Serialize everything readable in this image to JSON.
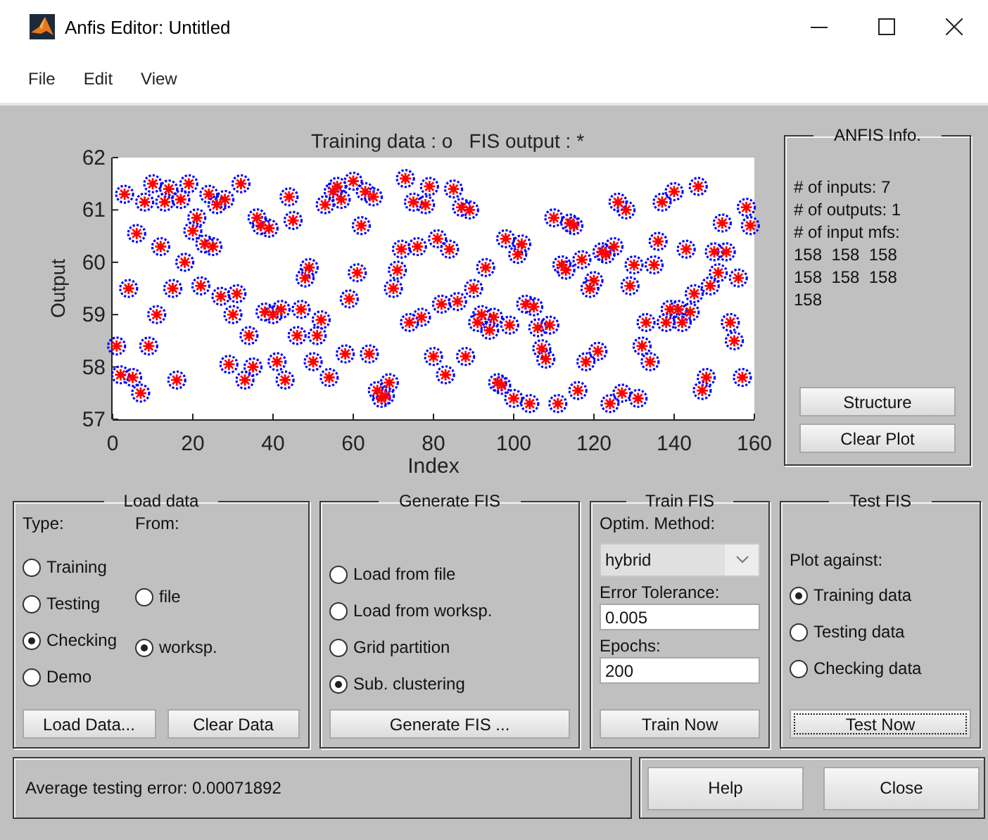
{
  "window": {
    "title": "Anfis Editor: Untitled"
  },
  "menu": [
    "File",
    "Edit",
    "View"
  ],
  "plot": {
    "chart_data": {
      "type": "scatter",
      "title": "Training data : o   FIS output : *",
      "xlabel": "Index",
      "ylabel": "Output",
      "xlim": [
        0,
        160
      ],
      "ylim": [
        57,
        62
      ],
      "xticks": [
        0,
        20,
        40,
        60,
        80,
        100,
        120,
        140,
        160
      ],
      "yticks": [
        57,
        58,
        59,
        60,
        61,
        62
      ],
      "x": [
        1,
        2,
        3,
        4,
        5,
        6,
        7,
        8,
        9,
        10,
        11,
        12,
        13,
        14,
        15,
        16,
        17,
        18,
        19,
        20,
        21,
        22,
        23,
        24,
        25,
        26,
        27,
        28,
        29,
        30,
        31,
        32,
        33,
        34,
        35,
        36,
        37,
        38,
        39,
        40,
        41,
        42,
        43,
        44,
        45,
        46,
        47,
        48,
        49,
        50,
        51,
        52,
        53,
        54,
        55,
        56,
        57,
        58,
        59,
        60,
        61,
        62,
        63,
        64,
        65,
        66,
        67,
        68,
        69,
        70,
        71,
        72,
        73,
        74,
        75,
        76,
        77,
        78,
        79,
        80,
        81,
        82,
        83,
        84,
        85,
        86,
        87,
        88,
        89,
        90,
        91,
        92,
        93,
        94,
        95,
        96,
        97,
        98,
        99,
        100,
        101,
        102,
        103,
        104,
        105,
        106,
        107,
        108,
        109,
        110,
        111,
        112,
        113,
        114,
        115,
        116,
        117,
        118,
        119,
        120,
        121,
        122,
        123,
        124,
        125,
        126,
        127,
        128,
        129,
        130,
        131,
        132,
        133,
        134,
        135,
        136,
        137,
        138,
        139,
        140,
        141,
        142,
        143,
        144,
        145,
        146,
        147,
        148,
        149,
        150,
        151,
        152,
        153,
        154,
        155,
        156,
        157,
        158,
        159
      ],
      "series": [
        {
          "color": "#0000ff",
          "values": [
            58.4,
            57.85,
            61.3,
            59.5,
            57.8,
            60.55,
            57.5,
            61.15,
            58.4,
            61.5,
            59.0,
            60.3,
            61.15,
            61.4,
            59.5,
            57.75,
            61.2,
            60.0,
            61.5,
            60.6,
            60.85,
            59.55,
            60.35,
            61.3,
            60.3,
            61.1,
            59.35,
            61.2,
            58.05,
            59.0,
            59.4,
            61.5,
            57.75,
            58.6,
            58.0,
            60.85,
            60.7,
            59.05,
            60.65,
            59.0,
            58.1,
            59.1,
            57.75,
            61.25,
            60.8,
            58.6,
            59.1,
            59.7,
            59.9,
            58.1,
            58.6,
            58.9,
            61.1,
            57.8,
            61.35,
            61.45,
            61.2,
            58.25,
            59.3,
            61.55,
            59.8,
            60.7,
            61.35,
            58.25,
            61.25,
            57.55,
            57.4,
            57.45,
            57.7,
            59.5,
            59.85,
            60.25,
            61.6,
            58.85,
            61.15,
            60.3,
            58.95,
            61.1,
            61.45,
            58.2,
            60.45,
            59.2,
            57.85,
            60.25,
            61.4,
            59.25,
            61.05,
            58.2,
            61.0,
            59.5,
            58.85,
            59.0,
            59.9,
            58.7,
            58.95,
            57.7,
            57.65,
            60.45,
            58.8,
            57.4,
            60.15,
            60.35,
            59.2,
            57.3,
            59.15,
            58.75,
            58.35,
            58.15,
            58.8,
            60.85,
            57.3,
            59.95,
            59.85,
            60.75,
            60.7,
            57.55,
            60.05,
            58.1,
            59.5,
            59.65,
            58.3,
            60.2,
            60.15,
            57.3,
            60.3,
            61.15,
            57.5,
            61.0,
            59.55,
            59.95,
            57.4,
            58.4,
            58.85,
            58.1,
            59.95,
            60.4,
            61.15,
            58.85,
            59.1,
            61.35,
            59.1,
            58.85,
            60.25,
            59.05,
            59.4,
            61.45,
            57.55,
            57.8,
            59.55,
            60.2,
            59.8,
            60.75,
            60.2,
            58.85,
            58.5,
            59.7,
            57.8,
            61.05,
            60.7
          ]
        },
        {
          "color": "#ff0000",
          "values": [
            58.4,
            57.85,
            61.3,
            59.5,
            57.8,
            60.55,
            57.5,
            61.15,
            58.4,
            61.5,
            59.0,
            60.3,
            61.15,
            61.4,
            59.5,
            57.75,
            61.2,
            60.0,
            61.5,
            60.6,
            60.85,
            59.55,
            60.35,
            61.3,
            60.3,
            61.1,
            59.35,
            61.2,
            58.05,
            59.0,
            59.4,
            61.5,
            57.75,
            58.6,
            58.0,
            60.85,
            60.7,
            59.05,
            60.65,
            59.0,
            58.1,
            59.1,
            57.75,
            61.25,
            60.8,
            58.6,
            59.1,
            59.7,
            59.9,
            58.1,
            58.6,
            58.9,
            61.1,
            57.8,
            61.35,
            61.45,
            61.2,
            58.25,
            59.3,
            61.55,
            59.8,
            60.7,
            61.35,
            58.25,
            61.25,
            57.55,
            57.4,
            57.45,
            57.7,
            59.5,
            59.85,
            60.25,
            61.6,
            58.85,
            61.15,
            60.3,
            58.95,
            61.1,
            61.45,
            58.2,
            60.45,
            59.2,
            57.85,
            60.25,
            61.4,
            59.25,
            61.05,
            58.2,
            61.0,
            59.5,
            58.85,
            59.0,
            59.9,
            58.7,
            58.95,
            57.7,
            57.65,
            60.45,
            58.8,
            57.4,
            60.15,
            60.35,
            59.2,
            57.3,
            59.15,
            58.75,
            58.35,
            58.15,
            58.8,
            60.85,
            57.3,
            59.95,
            59.85,
            60.75,
            60.7,
            57.55,
            60.05,
            58.1,
            59.5,
            59.65,
            58.3,
            60.2,
            60.15,
            57.3,
            60.3,
            61.15,
            57.5,
            61.0,
            59.55,
            59.95,
            57.4,
            58.4,
            58.85,
            58.1,
            59.95,
            60.4,
            61.15,
            58.85,
            59.1,
            61.35,
            59.1,
            58.85,
            60.25,
            59.05,
            59.4,
            61.45,
            57.55,
            57.8,
            59.55,
            60.2,
            59.8,
            60.75,
            60.2,
            58.85,
            58.5,
            59.7,
            57.8,
            61.05,
            60.7
          ]
        }
      ]
    }
  },
  "anfis_info": {
    "title": "ANFIS Info.",
    "lines": [
      "# of inputs: 7",
      "# of outputs: 1",
      "# of input mfs:",
      "158  158  158",
      "158  158  158",
      "158"
    ],
    "buttons": [
      "Structure",
      "Clear Plot"
    ]
  },
  "load_data": {
    "title": "Load data",
    "type_label": "Type:",
    "from_label": "From:",
    "type_options": [
      {
        "label": "Training",
        "selected": false
      },
      {
        "label": "Testing",
        "selected": false
      },
      {
        "label": "Checking",
        "selected": true
      },
      {
        "label": "Demo",
        "selected": false
      }
    ],
    "from_options": [
      {
        "label": "file",
        "selected": false
      },
      {
        "label": "worksp.",
        "selected": true
      }
    ],
    "buttons": [
      "Load Data...",
      "Clear Data"
    ]
  },
  "generate_fis": {
    "title": "Generate FIS",
    "options": [
      {
        "label": "Load from file",
        "selected": false
      },
      {
        "label": "Load from worksp.",
        "selected": false
      },
      {
        "label": "Grid partition",
        "selected": false
      },
      {
        "label": "Sub. clustering",
        "selected": true
      }
    ],
    "button": "Generate FIS ..."
  },
  "train_fis": {
    "title": "Train FIS",
    "method_label": "Optim. Method:",
    "method": "hybrid",
    "tolerance_label": "Error Tolerance:",
    "tolerance": "0.005",
    "epochs_label": "Epochs:",
    "epochs": "200",
    "button": "Train Now"
  },
  "test_fis": {
    "title": "Test FIS",
    "plot_label": "Plot against:",
    "options": [
      {
        "label": "Training data",
        "selected": true
      },
      {
        "label": "Testing data",
        "selected": false
      },
      {
        "label": "Checking data",
        "selected": false
      }
    ],
    "button": {
      "label": "Test Now",
      "focused": true
    }
  },
  "status": "Average testing error: 0.00071892",
  "buttons": [
    "Help",
    "Close"
  ]
}
